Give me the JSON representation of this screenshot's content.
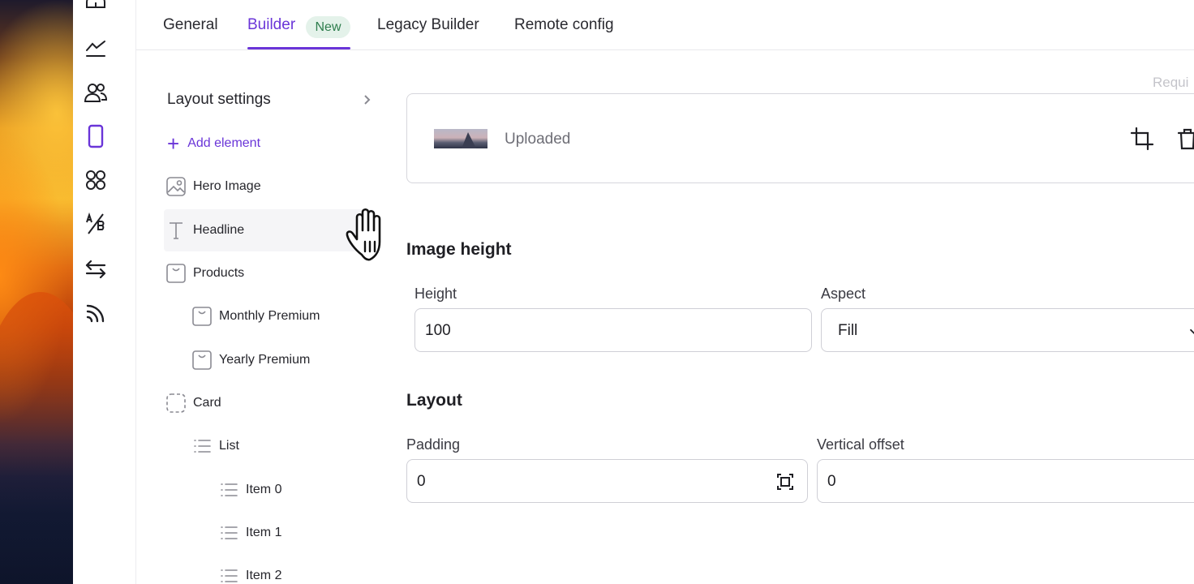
{
  "tabs": [
    {
      "label": "General"
    },
    {
      "label": "Builder",
      "badge": "New",
      "active": true
    },
    {
      "label": "Legacy Builder"
    },
    {
      "label": "Remote config"
    }
  ],
  "rail": {
    "icons": [
      "dashboard-icon",
      "chart-line-icon",
      "users-icon",
      "mobile-icon",
      "apps-grid-icon",
      "ab-test-icon",
      "transfer-icon",
      "rss-feed-icon"
    ]
  },
  "tree": {
    "layout_settings": "Layout settings",
    "add_element": "Add element",
    "items": [
      {
        "label": "Hero Image",
        "icon": "image-icon"
      },
      {
        "label": "Headline",
        "icon": "text-icon"
      },
      {
        "label": "Products",
        "icon": "product-box-icon"
      },
      {
        "label": "Monthly Premium",
        "icon": "product-box-icon"
      },
      {
        "label": "Yearly Premium",
        "icon": "product-box-icon"
      },
      {
        "label": "Card",
        "icon": "card-dashed-icon"
      },
      {
        "label": "List",
        "icon": "list-icon"
      },
      {
        "label": "Item 0",
        "icon": "list-icon"
      },
      {
        "label": "Item 1",
        "icon": "list-icon"
      },
      {
        "label": "Item 2",
        "icon": "list-icon"
      }
    ]
  },
  "main": {
    "required_label": "Requi",
    "upload": {
      "status": "Uploaded"
    },
    "image_height": {
      "title": "Image height",
      "height_label": "Height",
      "height_value": "100",
      "aspect_label": "Aspect",
      "aspect_value": "Fill"
    },
    "layout": {
      "title": "Layout",
      "padding_label": "Padding",
      "padding_value": "0",
      "vertical_offset_label": "Vertical offset",
      "vertical_offset_value": "0"
    }
  },
  "colors": {
    "accent": "#6a35d8",
    "badge_bg": "#e4f2ea",
    "badge_text": "#2e7d4d"
  }
}
